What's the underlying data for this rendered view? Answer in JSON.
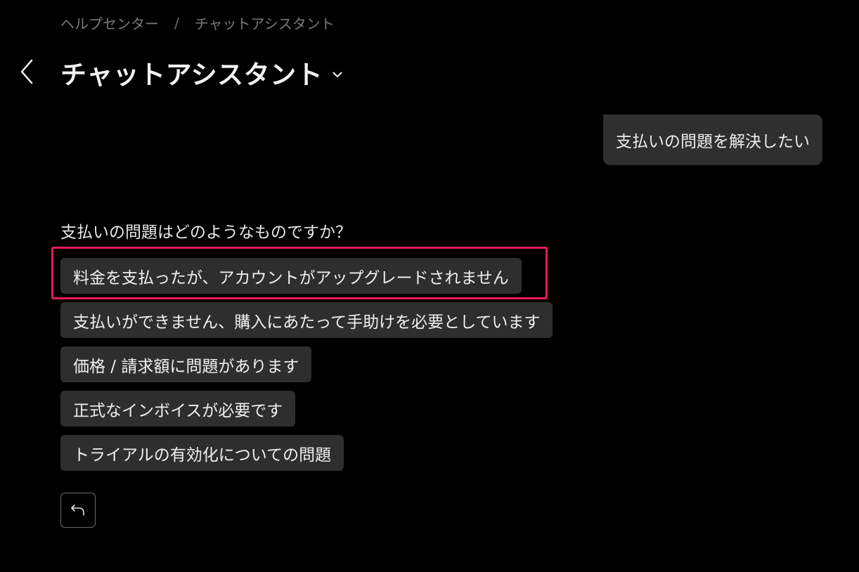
{
  "breadcrumb": {
    "items": [
      "ヘルプセンター",
      "チャットアシスタント"
    ],
    "separator": "/"
  },
  "header": {
    "title": "チャットアシスタント",
    "back_icon": "chevron-left-icon",
    "dropdown_icon": "chevron-down-icon"
  },
  "chat": {
    "user_message": "支払いの問題を解決したい",
    "assistant_question": "支払いの問題はどのようなものですか？",
    "options": [
      "料金を支払ったが、アカウントがアップグレードされません",
      "支払いができません、購入にあたって手助けを必要としています",
      "価格 / 請求額に問題があります",
      "正式なインボイスが必要です",
      "トライアルの有効化についての問題"
    ],
    "undo_icon": "undo-arrow-icon"
  },
  "colors": {
    "background": "#000000",
    "bubble": "#2f2f2f",
    "option": "#2e2e2e",
    "highlight": "#e8195a",
    "muted_text": "#7a7a7a"
  }
}
